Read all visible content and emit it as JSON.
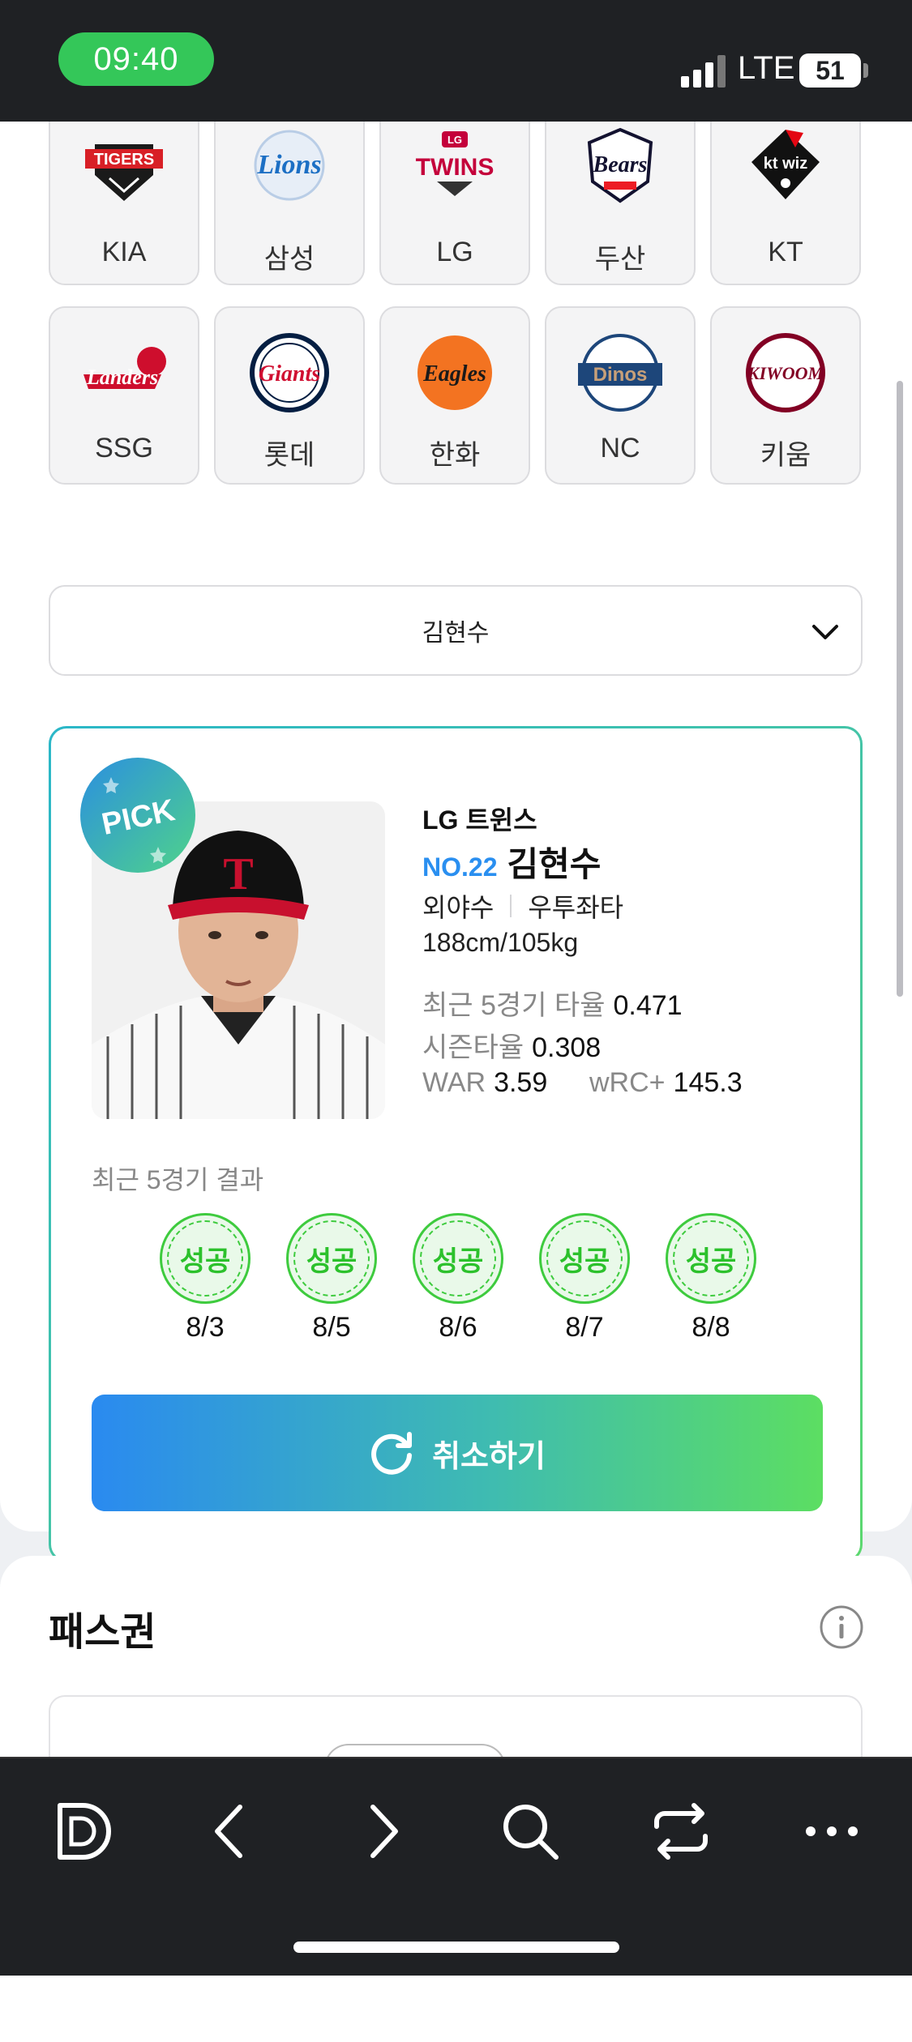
{
  "status_bar": {
    "time": "09:40",
    "network": "LTE",
    "battery": "51"
  },
  "teams": [
    {
      "name": "KIA",
      "logo": "tigers-logo"
    },
    {
      "name": "삼성",
      "logo": "lions-logo"
    },
    {
      "name": "LG",
      "logo": "twins-logo"
    },
    {
      "name": "두산",
      "logo": "bears-logo"
    },
    {
      "name": "KT",
      "logo": "ktwiz-logo"
    },
    {
      "name": "SSG",
      "logo": "landers-logo"
    },
    {
      "name": "롯데",
      "logo": "giants-logo"
    },
    {
      "name": "한화",
      "logo": "eagles-logo"
    },
    {
      "name": "NC",
      "logo": "dinos-logo"
    },
    {
      "name": "키움",
      "logo": "kiwoom-logo"
    }
  ],
  "logo_text": {
    "tigers": "TIGERS",
    "lions": "Lions",
    "twins": "TWINS",
    "twins_top": "LG",
    "bears": "Bears",
    "ktwiz": "kt wiz",
    "landers": "Landers",
    "giants": "Giants",
    "eagles": "Eagles",
    "dinos": "Dinos",
    "kiwoom": "KIWOOM"
  },
  "player_select": {
    "value": "김현수"
  },
  "player": {
    "pick_badge": "PICK",
    "team": "LG 트윈스",
    "number": "NO.22",
    "name": "김현수",
    "position": "외야수",
    "bats_throws": "우투좌타",
    "body": "188cm/105kg",
    "stats": {
      "recent5_label": "최근 5경기 타율",
      "recent5_value": "0.471",
      "season_label": "시즌타율",
      "season_value": "0.308",
      "war_label": "WAR",
      "war_value": "3.59",
      "wrc_label": "wRC+",
      "wrc_value": "145.3"
    },
    "recent_title": "최근 5경기 결과",
    "results": [
      {
        "label": "성공",
        "date": "8/3"
      },
      {
        "label": "성공",
        "date": "8/5"
      },
      {
        "label": "성공",
        "date": "8/6"
      },
      {
        "label": "성공",
        "date": "8/7"
      },
      {
        "label": "성공",
        "date": "8/8"
      }
    ],
    "cancel_label": "취소하기"
  },
  "pass_section": {
    "title": "패스권"
  },
  "colors": {
    "accent_blue": "#2a8ff0",
    "success_green": "#2cc12c",
    "status_pill": "#34c759"
  },
  "toolbar_icons": [
    "d-logo-icon",
    "back-icon",
    "forward-icon",
    "search-icon",
    "sync-icon",
    "more-icon"
  ]
}
